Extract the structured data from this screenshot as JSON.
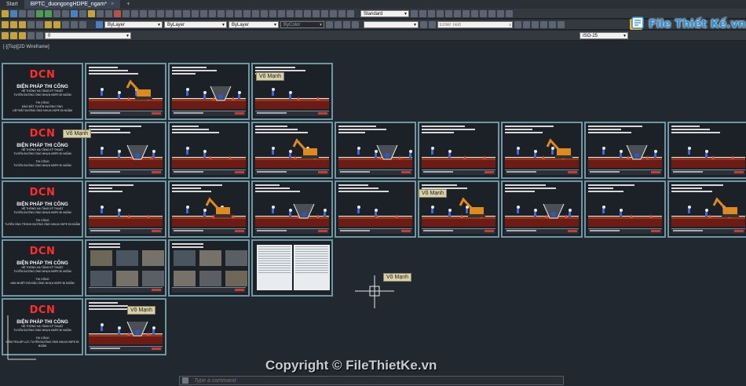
{
  "tabs": [
    {
      "label": "Start"
    },
    {
      "label": "BPTC_duongongHDPE_ngam*",
      "close": "×"
    }
  ],
  "new_tab": "+",
  "toolbar": {
    "text_style": "Standard",
    "search_placeholder": "Enter Text",
    "layer_value": "0",
    "color_value": "ByLayer",
    "linetype_value": "ByLayer",
    "lineweight_value": "ByLayer",
    "plotstyle_value": "ByColor",
    "dim_style": "ISO-25"
  },
  "viewport_label": "[-][Top][2D Wireframe]",
  "covers": [
    {
      "logo": "DCN",
      "title": "BIỆN PHÁP THI CÔNG",
      "sub1": "HỆ THỐNG HẠ TẦNG KỸ THUẬT",
      "sub2": "TUYẾN ĐƯỜNG ỐNG NHỰA HDPE ĐI NGẦM",
      "small1": "THI CÔNG",
      "small2": "ĐÀO ĐẤT TUYẾN ĐƯỜNG ỐNG",
      "small3": "LẮP ĐẶT ĐƯỜNG ỐNG NHỰA HDPE ĐI NGẦM"
    },
    {
      "logo": "DCN",
      "title": "BIỆN PHÁP THI CÔNG",
      "sub1": "HỆ THỐNG HẠ TẦNG KỸ THUẬT",
      "sub2": "TUYẾN ĐƯỜNG ỐNG NHỰA HDPE ĐI NGẦM",
      "small1": "THI CÔNG",
      "small2": "TUYẾN ĐƯỜNG ỐNG NHỰA HDPE ĐI NGẦM",
      "small3": ""
    },
    {
      "logo": "DCN",
      "title": "BIỆN PHÁP THI CÔNG",
      "sub1": "HỆ THỐNG HẠ TẦNG KỸ THUẬT",
      "sub2": "TUYẾN ĐƯỜNG ỐNG NHỰA HDPE ĐI NGẦM",
      "small1": "THI CÔNG",
      "small2": "TUYẾN ỐNG TRONG ĐƯỜNG ỐNG NHỰA HDPE ĐI NGẦM",
      "small3": ""
    },
    {
      "logo": "DCN",
      "title": "BIỆN PHÁP THI CÔNG",
      "sub1": "HỆ THỐNG HẠ TẦNG KỸ THUẬT",
      "sub2": "TUYẾN ĐƯỜNG ỐNG NHỰA HDPE ĐI NGẦM",
      "small1": "THI CÔNG",
      "small2": "HÀN NHIỆT ĐỐI ĐẦU ỐNG NHỰA HDPE ĐI NGẦM",
      "small3": ""
    },
    {
      "logo": "DCN",
      "title": "BIỆN PHÁP THI CÔNG",
      "sub1": "HỆ THỐNG HẠ TẦNG KỸ THUẬT",
      "sub2": "TUYẾN ĐƯỜNG ỐNG NHỰA HDPE ĐI NGẦM",
      "small1": "THI CÔNG",
      "small2": "KIỂM TRA ÁP LỰC TUYẾN ĐƯỜNG ỐNG NHỰA HDPE ĐI NGẦM",
      "small3": ""
    }
  ],
  "tooltips": [
    "Võ Mạnh",
    "Võ Mạnh",
    "Võ Mạnh",
    "Võ Mạnh",
    "Võ Mạnh"
  ],
  "command_placeholder": "Type a command",
  "copyright": "Copyright © FileThietKe.vn",
  "watermark": "File Thiết Kế.vn",
  "colors": {
    "canvas": "#212830",
    "sheet_border": "#6e96a3",
    "logo_red": "#ff2d2d",
    "soil": "#6d1c15"
  }
}
